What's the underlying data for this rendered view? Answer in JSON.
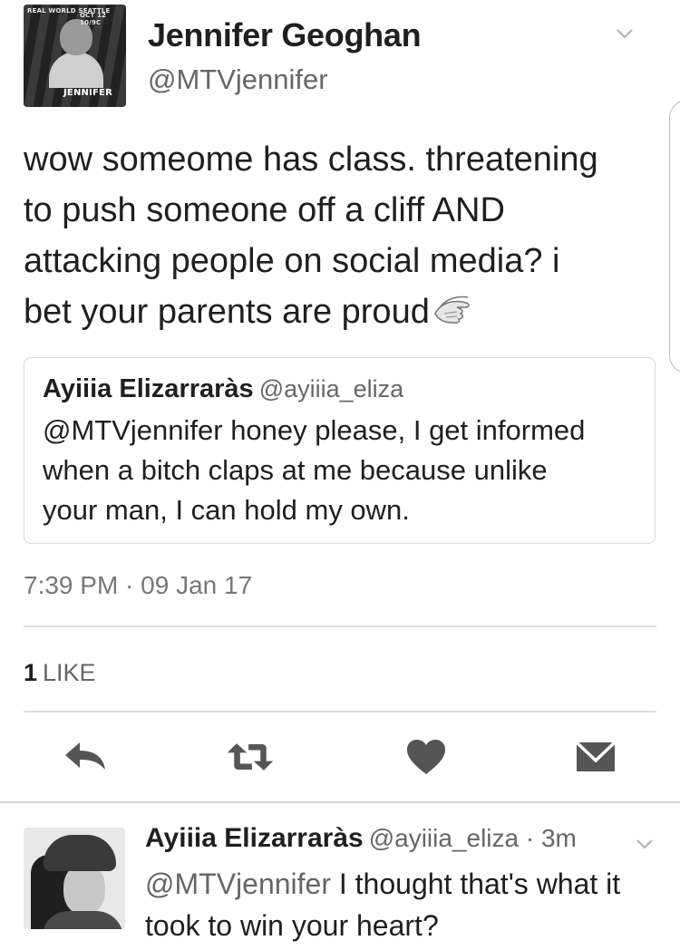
{
  "tweet": {
    "avatar_text": {
      "line1": "REAL WORLD SEATTLE",
      "line2": "OCT 12 10/9C",
      "line3": "JENNIFER"
    },
    "display_name": "Jennifer Geoghan",
    "screen_name": "@MTVjennifer",
    "text": "wow someome has class. threatening\nto push someone off a cliff AND\nattacking people on social media? i\nbet your parents are proud",
    "timestamp": "7:39 PM · 09 Jan 17",
    "like_count": "1",
    "like_label": "LIKE"
  },
  "quoted_tweet": {
    "display_name": "Ayiiia Elizarraràs",
    "screen_name": "@ayiiia_eliza",
    "text": "@MTVjennifer honey please, I get informed\nwhen a bitch claps at me because unlike\nyour man, I can hold my own."
  },
  "reply": {
    "display_name": "Ayiiia Elizarraràs",
    "meta": "@ayiiia_eliza · 3m",
    "mention": "@MTVjennifer",
    "text": " I thought that's what it took to win your heart?"
  },
  "icons": {
    "chevron": "chevron-down-icon",
    "clap": "clapping-hands-icon",
    "reply": "reply-icon",
    "retweet": "retweet-icon",
    "like": "heart-icon",
    "message": "envelope-icon"
  },
  "colors": {
    "text": "#1f1f1f",
    "secondary": "#666666",
    "icon": "#555555"
  }
}
